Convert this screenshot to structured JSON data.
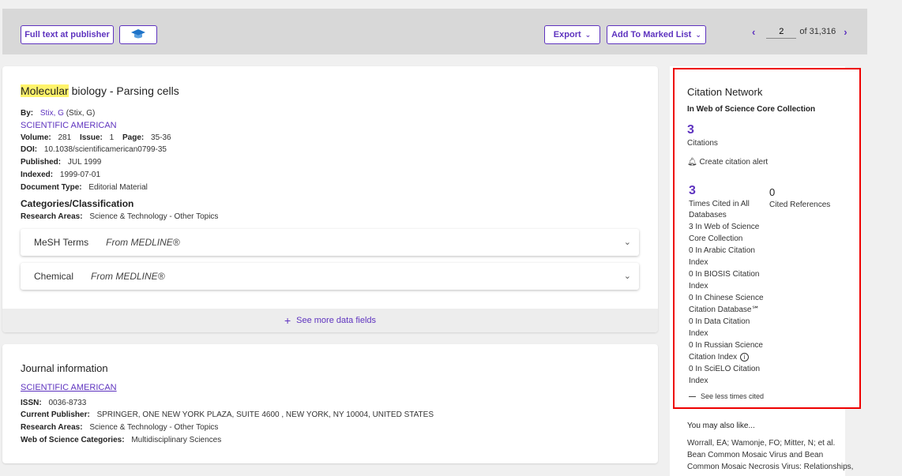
{
  "toolbar": {
    "full_text": "Full text at publisher",
    "export": "Export",
    "add_marked": "Add To Marked List",
    "page_value": "2",
    "page_of": "of 31,316"
  },
  "record": {
    "title_highlight": "Molecular",
    "title_rest": " biology - Parsing cells",
    "by_label": "By:",
    "author": "Stix, G",
    "author_full": "(Stix, G)",
    "journal": "SCIENTIFIC AMERICAN",
    "volume_label": "Volume:",
    "volume": "281",
    "issue_label": "Issue:",
    "issue": "1",
    "page_label": "Page:",
    "pages": "35-36",
    "doi_label": "DOI:",
    "doi": "10.1038/scientificamerican0799-35",
    "published_label": "Published:",
    "published": "JUL 1999",
    "indexed_label": "Indexed:",
    "indexed": "1999-07-01",
    "doctype_label": "Document Type:",
    "doctype": "Editorial Material",
    "categories_heading": "Categories/Classification",
    "research_label": "Research Areas:",
    "research": "Science & Technology - Other Topics",
    "mesh_label": "MeSH Terms",
    "mesh_src": "From MEDLINE®",
    "chemical_label": "Chemical",
    "chemical_src": "From MEDLINE®",
    "see_more": "See more data fields"
  },
  "journal_info": {
    "heading": "Journal information",
    "name": "SCIENTIFIC AMERICAN",
    "issn_label": "ISSN:",
    "issn": "0036-8733",
    "publisher_label": "Current Publisher:",
    "publisher": "SPRINGER, ONE NEW YORK PLAZA, SUITE 4600 , NEW YORK, NY 10004, UNITED STATES",
    "research_label": "Research Areas:",
    "research": "Science & Technology - Other Topics",
    "wos_label": "Web of Science Categories:",
    "wos": "Multidisciplinary Sciences"
  },
  "citation_network": {
    "heading": "Citation Network",
    "sub": "In Web of Science Core Collection",
    "citations_count": "3",
    "citations_label": "Citations",
    "alert": "Create citation alert",
    "times_cited_count": "3",
    "times_cited_label1": "Times Cited in All",
    "times_cited_label2": "Databases",
    "cited_refs_count": "0",
    "cited_refs_label": "Cited References",
    "db_lines": [
      "3 In Web of Science",
      "Core Collection",
      "0 In Arabic Citation",
      "Index",
      "0 In BIOSIS Citation",
      "Index",
      "0 In Chinese Science",
      "Citation Database℠",
      "0 In Data Citation",
      "Index",
      "0 In Russian Science",
      "Citation Index",
      "0 In SciELO Citation",
      "Index"
    ],
    "see_less": "See less times cited"
  },
  "also_like": {
    "heading": "You may also like...",
    "authors": "Worrall, EA; Wamonje, FO; Mitter, N; et al.",
    "title1": "Bean Common Mosaic Virus and Bean",
    "title2": "Common Mosaic Necrosis Virus: Relationships,"
  },
  "colors": {
    "accent": "#5e33bf",
    "highlight": "#fff36b",
    "red_box": "#e00000"
  }
}
